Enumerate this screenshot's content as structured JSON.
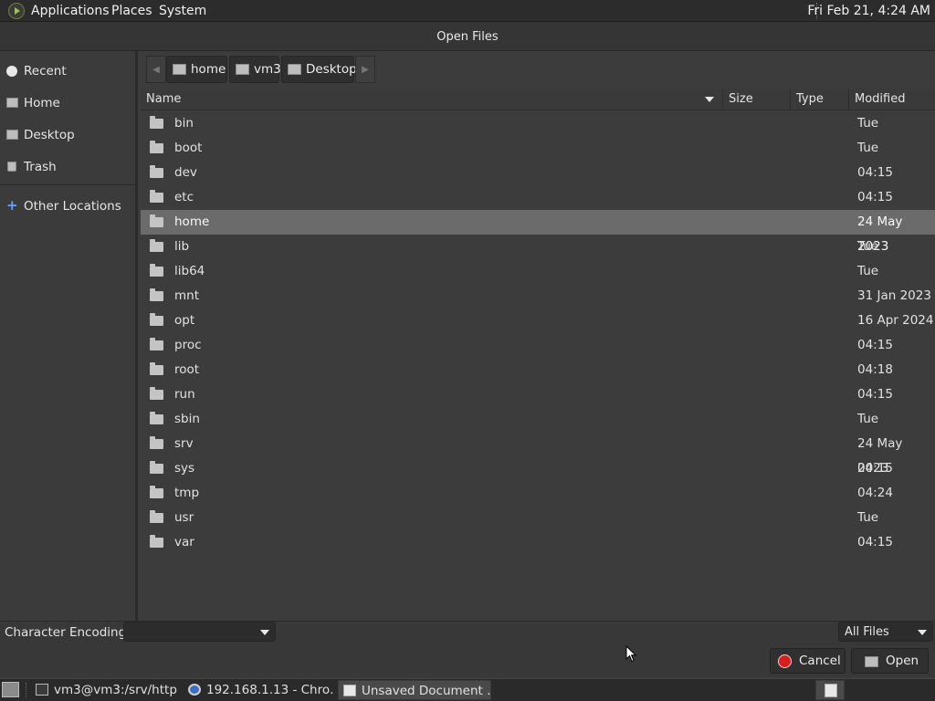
{
  "top_panel": {
    "menus": [
      "Applications",
      "Places",
      "System"
    ],
    "clock": "Fri Feb 21,  4:24 AM"
  },
  "dialog": {
    "title": "Open Files"
  },
  "sidebar": {
    "items": [
      {
        "label": "Recent",
        "icon": "clock-icon"
      },
      {
        "label": "Home",
        "icon": "home-folder-icon"
      },
      {
        "label": "Desktop",
        "icon": "desktop-folder-icon"
      },
      {
        "label": "Trash",
        "icon": "trash-icon"
      },
      {
        "label": "Other Locations",
        "icon": "plus-icon"
      }
    ]
  },
  "pathbar": {
    "crumbs": [
      "home",
      "vm3",
      "Desktop"
    ]
  },
  "columns": {
    "name": "Name",
    "size": "Size",
    "type": "Type",
    "modified": "Modified"
  },
  "files": [
    {
      "name": "bin",
      "modified": "Tue"
    },
    {
      "name": "boot",
      "modified": "Tue"
    },
    {
      "name": "dev",
      "modified": "04:15"
    },
    {
      "name": "etc",
      "modified": "04:15"
    },
    {
      "name": "home",
      "modified": "24 May 2023",
      "selected": true
    },
    {
      "name": "lib",
      "modified": "Tue"
    },
    {
      "name": "lib64",
      "modified": "Tue"
    },
    {
      "name": "mnt",
      "modified": "31 Jan 2023"
    },
    {
      "name": "opt",
      "modified": "16 Apr 2024"
    },
    {
      "name": "proc",
      "modified": "04:15"
    },
    {
      "name": "root",
      "modified": "04:18"
    },
    {
      "name": "run",
      "modified": "04:15"
    },
    {
      "name": "sbin",
      "modified": "Tue"
    },
    {
      "name": "srv",
      "modified": "24 May 2023"
    },
    {
      "name": "sys",
      "modified": "04:15"
    },
    {
      "name": "tmp",
      "modified": "04:24"
    },
    {
      "name": "usr",
      "modified": "Tue"
    },
    {
      "name": "var",
      "modified": "04:15"
    }
  ],
  "bottom": {
    "encoding_label": "Character Encoding:",
    "encoding_value": "",
    "filter": "All Files",
    "cancel": "Cancel",
    "open": "Open"
  },
  "taskbar": {
    "tasks": [
      {
        "label": "vm3@vm3:/srv/http",
        "icon": "terminal-icon"
      },
      {
        "label": "192.168.1.13 - Chro…",
        "icon": "chrome-icon"
      },
      {
        "label": "Unsaved Document …",
        "icon": "text-editor-icon",
        "active": true
      }
    ]
  }
}
